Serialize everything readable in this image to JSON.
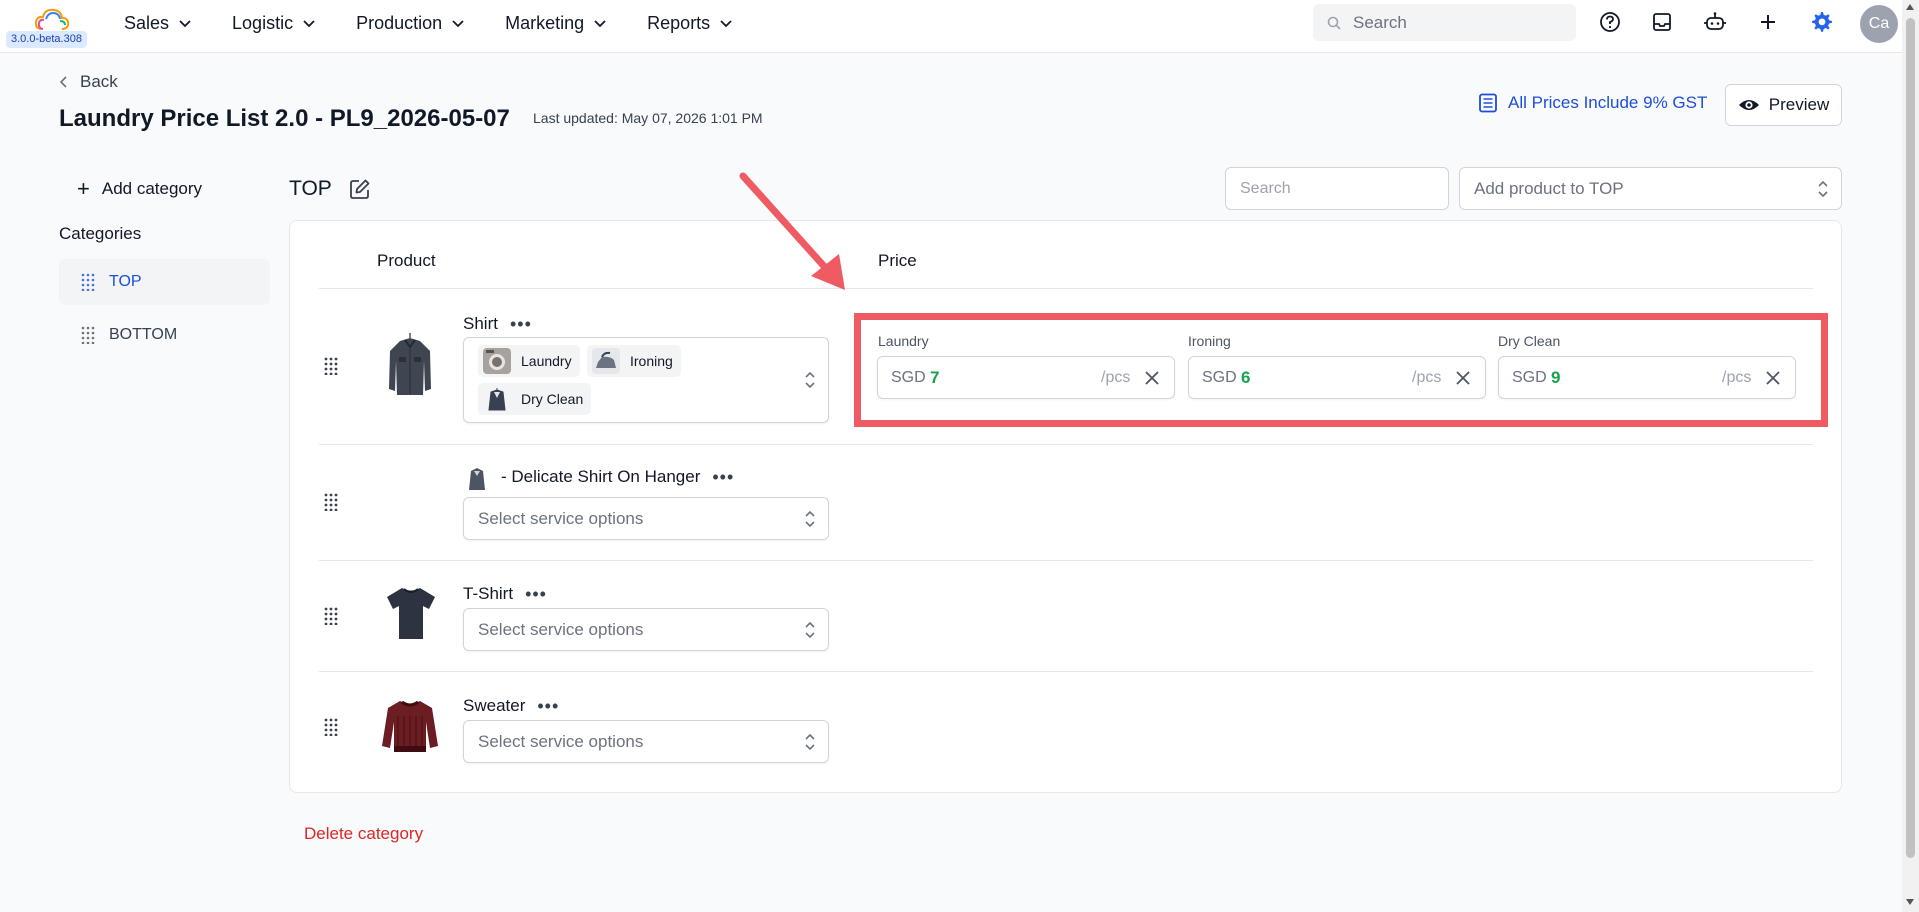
{
  "app": {
    "version": "3.0.0-beta.308",
    "nav": [
      {
        "label": "Sales"
      },
      {
        "label": "Logistic"
      },
      {
        "label": "Production"
      },
      {
        "label": "Marketing"
      },
      {
        "label": "Reports"
      }
    ],
    "search_placeholder": "Search",
    "avatar_initials": "Ca",
    "accent": "#1d4ed8"
  },
  "header": {
    "back_label": "Back",
    "title": "Laundry Price List 2.0 - PL9_2026-05-07",
    "last_updated": "Last updated: May 07, 2026 1:01 PM",
    "gst_label": "All Prices Include 9% GST",
    "preview_label": "Preview"
  },
  "sidebar": {
    "add_category": "Add category",
    "heading": "Categories",
    "items": [
      {
        "label": "TOP",
        "active": true
      },
      {
        "label": "BOTTOM",
        "active": false
      }
    ]
  },
  "main": {
    "section_title": "TOP",
    "search_placeholder": "Search",
    "add_product_placeholder": "Add product to TOP",
    "col_product": "Product",
    "col_price": "Price",
    "delete_category": "Delete category",
    "service_placeholder": "Select service options",
    "products": [
      {
        "name": "Shirt",
        "services": [
          "Laundry",
          "Ironing",
          "Dry Clean"
        ],
        "prices": [
          {
            "label": "Laundry",
            "currency": "SGD",
            "value": "7",
            "unit": "/pcs"
          },
          {
            "label": "Ironing",
            "currency": "SGD",
            "value": "6",
            "unit": "/pcs"
          },
          {
            "label": "Dry Clean",
            "currency": "SGD",
            "value": "9",
            "unit": "/pcs"
          }
        ]
      },
      {
        "name": "- Delicate Shirt On Hanger",
        "services": []
      },
      {
        "name": "T-Shirt",
        "services": []
      },
      {
        "name": "Sweater",
        "services": []
      }
    ]
  },
  "colors": {
    "highlight": "#ef5b63",
    "price_value": "#16a34a",
    "danger": "#dc2626"
  }
}
